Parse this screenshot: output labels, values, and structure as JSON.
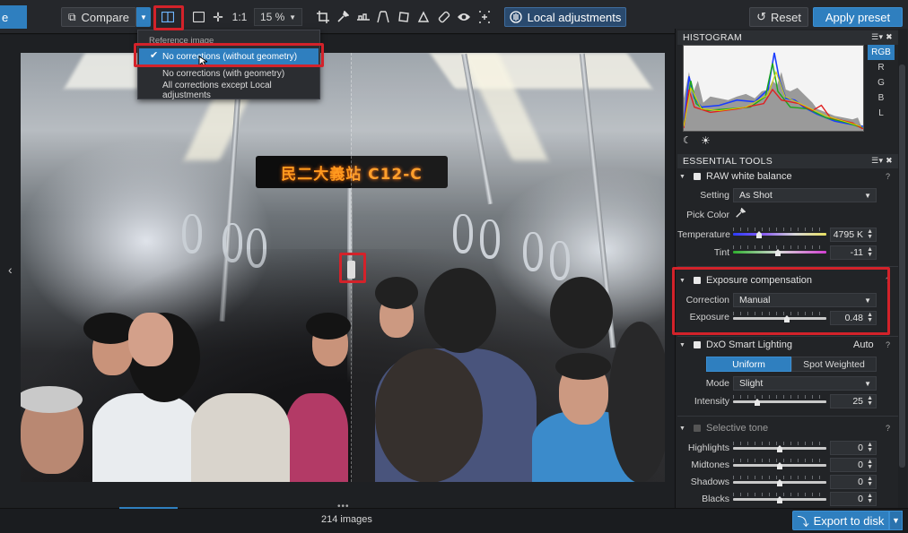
{
  "toolbar": {
    "left_tab_label": "e",
    "compare_label": "Compare",
    "one_to_one": "1:1",
    "zoom": "15 %",
    "local_adjustments": "Local adjustments",
    "reset": "Reset",
    "apply_preset": "Apply preset"
  },
  "reference_menu": {
    "heading": "Reference image",
    "items": [
      {
        "label": "No corrections (without geometry)",
        "selected": true
      },
      {
        "label": "No corrections (with geometry)",
        "selected": false
      },
      {
        "label": "All corrections except Local adjustments",
        "selected": false
      }
    ]
  },
  "photo": {
    "led_sign": "民二大義站 C12-C"
  },
  "bottom": {
    "image_count": "214 images",
    "export": "Export to disk"
  },
  "histogram": {
    "title": "HISTOGRAM",
    "channels": [
      "RGB",
      "R",
      "G",
      "B",
      "L"
    ],
    "selected_channel": "RGB"
  },
  "essential_tools": {
    "title": "ESSENTIAL TOOLS",
    "raw_wb": {
      "title": "RAW white balance",
      "setting_label": "Setting",
      "setting_value": "As Shot",
      "pick_color_label": "Pick Color",
      "temperature_label": "Temperature",
      "temperature_value": "4795 K",
      "tint_label": "Tint",
      "tint_value": "-11"
    },
    "exposure": {
      "title": "Exposure compensation",
      "correction_label": "Correction",
      "correction_value": "Manual",
      "exposure_label": "Exposure",
      "exposure_value": "0.48"
    },
    "smart_lighting": {
      "title": "DxO Smart Lighting",
      "status": "Auto",
      "mode_uniform": "Uniform",
      "mode_spot": "Spot Weighted",
      "mode_label": "Mode",
      "mode_value": "Slight",
      "intensity_label": "Intensity",
      "intensity_value": "25"
    },
    "selective_tone": {
      "title": "Selective tone",
      "rows": [
        {
          "label": "Highlights",
          "value": "0"
        },
        {
          "label": "Midtones",
          "value": "0"
        },
        {
          "label": "Shadows",
          "value": "0"
        },
        {
          "label": "Blacks",
          "value": "0"
        }
      ]
    }
  },
  "help_mark": "?",
  "colors": {
    "accent": "#2f7fbf",
    "highlight_box": "#d3222a",
    "panel": "#222427",
    "led": "#ff9a1f"
  }
}
